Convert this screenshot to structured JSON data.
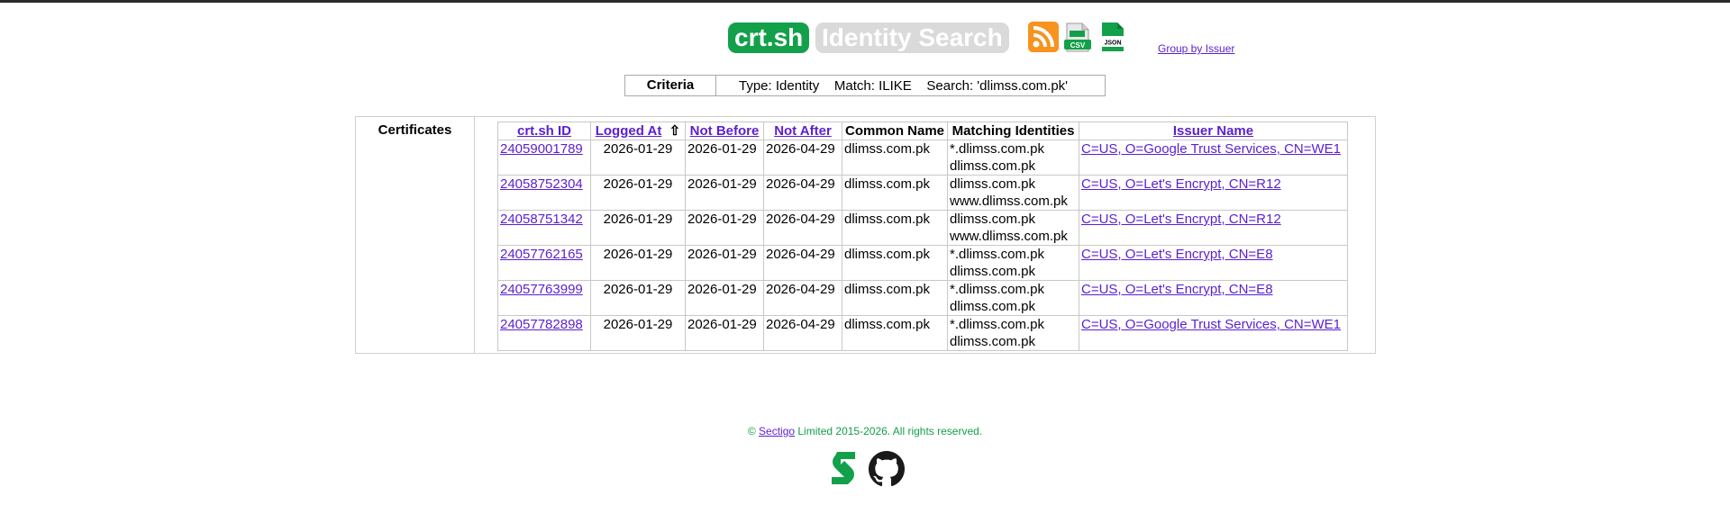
{
  "header": {
    "logo_text": "crt.sh",
    "subtitle": "Identity Search",
    "group_link": "Group by Issuer",
    "icons": [
      "rss-icon",
      "csv-icon",
      "json-icon"
    ],
    "csv_text": "CSV",
    "json_text": "JSON"
  },
  "criteria": {
    "label": "Criteria",
    "text": "Type: Identity    Match: ILIKE    Search: 'dlimss.com.pk'"
  },
  "certificates": {
    "label": "Certificates",
    "columns": [
      "crt.sh ID",
      "Logged At",
      "Not Before",
      "Not After",
      "Common Name",
      "Matching Identities",
      "Issuer Name"
    ],
    "sort_indicator": "⇧",
    "rows": [
      {
        "id": "24059001789",
        "logged": "2026-01-29",
        "not_before": "2026-01-29",
        "not_after": "2026-04-29",
        "common_name": "dlimss.com.pk",
        "identity_1": "*.dlimss.com.pk",
        "identity_2": "dlimss.com.pk",
        "issuer": "C=US, O=Google Trust Services, CN=WE1"
      },
      {
        "id": "24058752304",
        "logged": "2026-01-29",
        "not_before": "2026-01-29",
        "not_after": "2026-04-29",
        "common_name": "dlimss.com.pk",
        "identity_1": "dlimss.com.pk",
        "identity_2": "www.dlimss.com.pk",
        "issuer": "C=US, O=Let's Encrypt, CN=R12"
      },
      {
        "id": "24058751342",
        "logged": "2026-01-29",
        "not_before": "2026-01-29",
        "not_after": "2026-04-29",
        "common_name": "dlimss.com.pk",
        "identity_1": "dlimss.com.pk",
        "identity_2": "www.dlimss.com.pk",
        "issuer": "C=US, O=Let's Encrypt, CN=R12"
      },
      {
        "id": "24057762165",
        "logged": "2026-01-29",
        "not_before": "2026-01-29",
        "not_after": "2026-04-29",
        "common_name": "dlimss.com.pk",
        "identity_1": "*.dlimss.com.pk",
        "identity_2": "dlimss.com.pk",
        "issuer": "C=US, O=Let's Encrypt, CN=E8"
      },
      {
        "id": "24057763999",
        "logged": "2026-01-29",
        "not_before": "2026-01-29",
        "not_after": "2026-04-29",
        "common_name": "dlimss.com.pk",
        "identity_1": "*.dlimss.com.pk",
        "identity_2": "dlimss.com.pk",
        "issuer": "C=US, O=Let's Encrypt, CN=E8"
      },
      {
        "id": "24057782898",
        "logged": "2026-01-29",
        "not_before": "2026-01-29",
        "not_after": "2026-04-29",
        "common_name": "dlimss.com.pk",
        "identity_1": "*.dlimss.com.pk",
        "identity_2": "dlimss.com.pk",
        "issuer": "C=US, O=Google Trust Services, CN=WE1"
      }
    ]
  },
  "footer": {
    "copyright_prefix": "© ",
    "sectigo_link": "Sectigo",
    "copyright_suffix": " Limited 2015-2026. All rights reserved.",
    "icons": [
      "sectigo-icon",
      "github-icon"
    ]
  },
  "colors": {
    "brand_green": "#13a04a",
    "link_purple": "#5a1fd1",
    "subtitle_grey": "#dadada",
    "rss_orange": "#f7931e"
  }
}
